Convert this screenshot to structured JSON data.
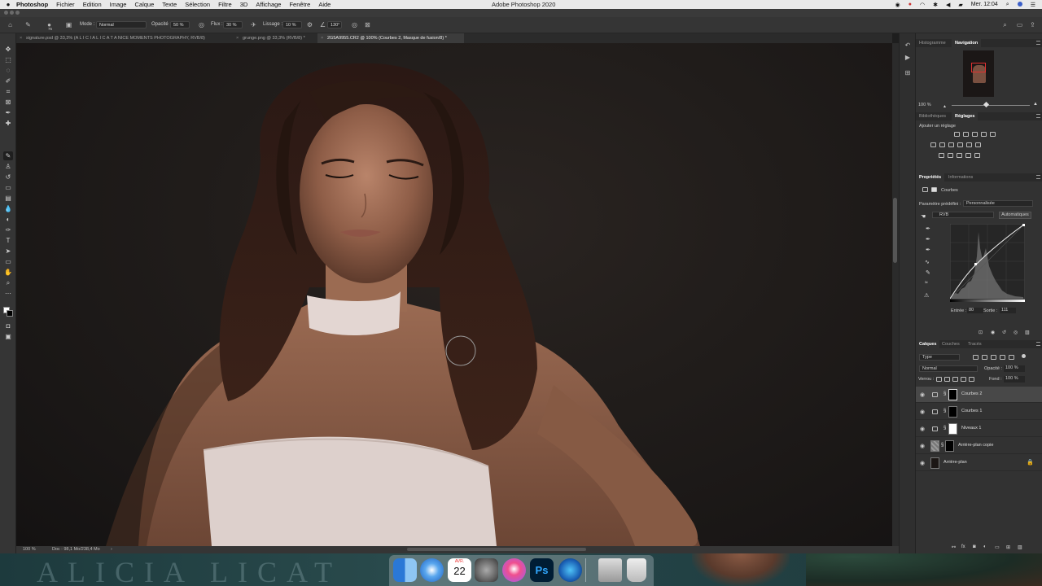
{
  "menubar": {
    "app_name": "Photoshop",
    "menus": [
      "Fichier",
      "Edition",
      "Image",
      "Calque",
      "Texte",
      "Sélection",
      "Filtre",
      "3D",
      "Affichage",
      "Fenêtre",
      "Aide"
    ],
    "window_title": "Adobe Photoshop 2020",
    "clock": "Mer. 12:04"
  },
  "options_bar": {
    "brush_size": "76",
    "mode_label": "Mode :",
    "mode_value": "Normal",
    "opacity_label": "Opacité :",
    "opacity_value": "50 %",
    "flow_label": "Flux :",
    "flow_value": "30 %",
    "smoothing_label": "Lissage :",
    "smoothing_value": "10 %",
    "angle_value": "130°"
  },
  "tabs": [
    {
      "label": "signature.psd @ 33,3% (A L I C I A   L I C A T A  NICE MOMENTS PHOTOGRAPHY, RVB/8)",
      "active": false
    },
    {
      "label": "grunge.png @ 33,3% (RVB/8) *",
      "active": false
    },
    {
      "label": "2G5A9955.CR2 @ 100% (Courbes 2, Masque de fusion/8) *",
      "active": true
    }
  ],
  "status_bar": {
    "zoom": "100 %",
    "doc_info": "Doc : 98,1 Mo/238,4 Mo"
  },
  "panels": {
    "top_tabs": [
      "Histogramme",
      "Navigation"
    ],
    "top_active": "Navigation",
    "nav_zoom": "100 %",
    "adjust_tabs": [
      "Bibliothèques",
      "Réglages"
    ],
    "adjust_active": "Réglages",
    "add_adjustment": "Ajouter un réglage",
    "props_tabs": [
      "Propriétés",
      "Informations"
    ],
    "props_active": "Propriétés",
    "props_type": "Courbes",
    "preset_label": "Paramètre prédéfini :",
    "preset_value": "Personnalisée",
    "channel_value": "RVB",
    "auto_button": "Automatiques",
    "input_label": "Entrée :",
    "input_value": "80",
    "output_label": "Sortie :",
    "output_value": "111",
    "layers_tabs": [
      "Calques",
      "Couches",
      "Tracés"
    ],
    "layers_active": "Calques",
    "filter_value": "Type",
    "blend_value": "Normal",
    "opacity_label": "Opacité :",
    "opacity_value": "100 %",
    "lock_label": "Verrou :",
    "fill_label": "Fond :",
    "fill_value": "100 %",
    "layers": [
      {
        "name": "Courbes 2",
        "selected": true
      },
      {
        "name": "Courbes 1",
        "selected": false
      },
      {
        "name": "Niveaux 1",
        "selected": false
      },
      {
        "name": "Arrière-plan copie",
        "selected": false
      },
      {
        "name": "Arrière-plan",
        "selected": false
      }
    ]
  },
  "dock": {
    "calendar_month": "AVR.",
    "calendar_day": "22",
    "watermark": "ALICIA LICAT"
  },
  "colors": {
    "panel_bg": "#323232",
    "toolbar_bg": "#353535",
    "selected_layer": "#484848"
  }
}
